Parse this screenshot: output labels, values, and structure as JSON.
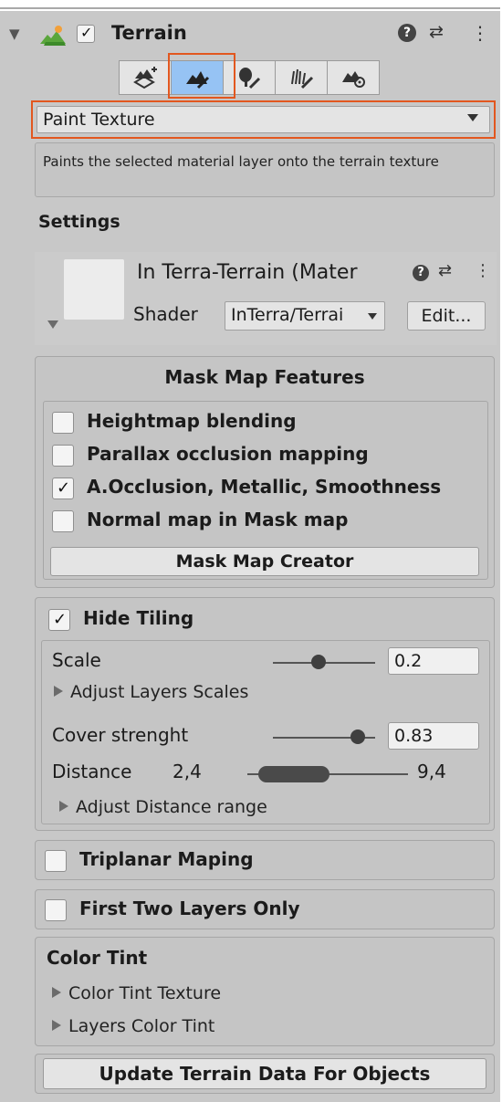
{
  "component": {
    "title": "Terrain",
    "enabled": true,
    "help_icon": "help-icon",
    "preset_icon": "preset-icon",
    "more_icon": "more-icon"
  },
  "toolbar": {
    "tools": [
      {
        "name": "create-neighbor-terrains",
        "icon": "terrain-plus-icon",
        "selected": false
      },
      {
        "name": "paint-terrain",
        "icon": "paint-terrain-icon",
        "selected": true
      },
      {
        "name": "paint-trees",
        "icon": "tree-brush-icon",
        "selected": false
      },
      {
        "name": "paint-details",
        "icon": "grass-brush-icon",
        "selected": false
      },
      {
        "name": "terrain-settings",
        "icon": "terrain-gear-icon",
        "selected": false
      }
    ]
  },
  "tool_dropdown": {
    "value": "Paint Texture"
  },
  "description": "Paints the selected material layer onto the terrain texture",
  "settings_label": "Settings",
  "material": {
    "name": "In Terra-Terrain (Mater",
    "shader_label": "Shader",
    "shader_value": "InTerra/Terrai",
    "edit_label": "Edit..."
  },
  "mask_map": {
    "title": "Mask Map Features",
    "options": [
      {
        "label": "Heightmap blending",
        "checked": false
      },
      {
        "label": "Parallax occlusion mapping",
        "checked": false
      },
      {
        "label": "A.Occlusion, Metallic, Smoothness",
        "checked": true
      },
      {
        "label": "Normal map in Mask map",
        "checked": false
      }
    ],
    "creator_button": "Mask Map Creator"
  },
  "hide_tiling": {
    "label": "Hide Tiling",
    "checked": true,
    "scale_label": "Scale",
    "scale_value": "0.2",
    "scale_slider_fraction": 0.45,
    "adjust_layers": "Adjust Layers Scales",
    "cover_label": "Cover strenght",
    "cover_value": "0.83",
    "cover_slider_fraction": 0.83,
    "distance_label": "Distance",
    "distance_min": "2,4",
    "distance_max": "9,4",
    "adjust_distance": "Adjust Distance range"
  },
  "triplanar": {
    "label": "Triplanar Maping",
    "checked": false
  },
  "first_two": {
    "label": "First Two Layers Only",
    "checked": false
  },
  "color_tint": {
    "title": "Color Tint",
    "texture": "Color Tint Texture",
    "layers": "Layers Color Tint"
  },
  "update_button": "Update Terrain Data For Objects",
  "colors": {
    "accent_selection": "#e2571f",
    "selected_tool": "#96c3f4"
  }
}
